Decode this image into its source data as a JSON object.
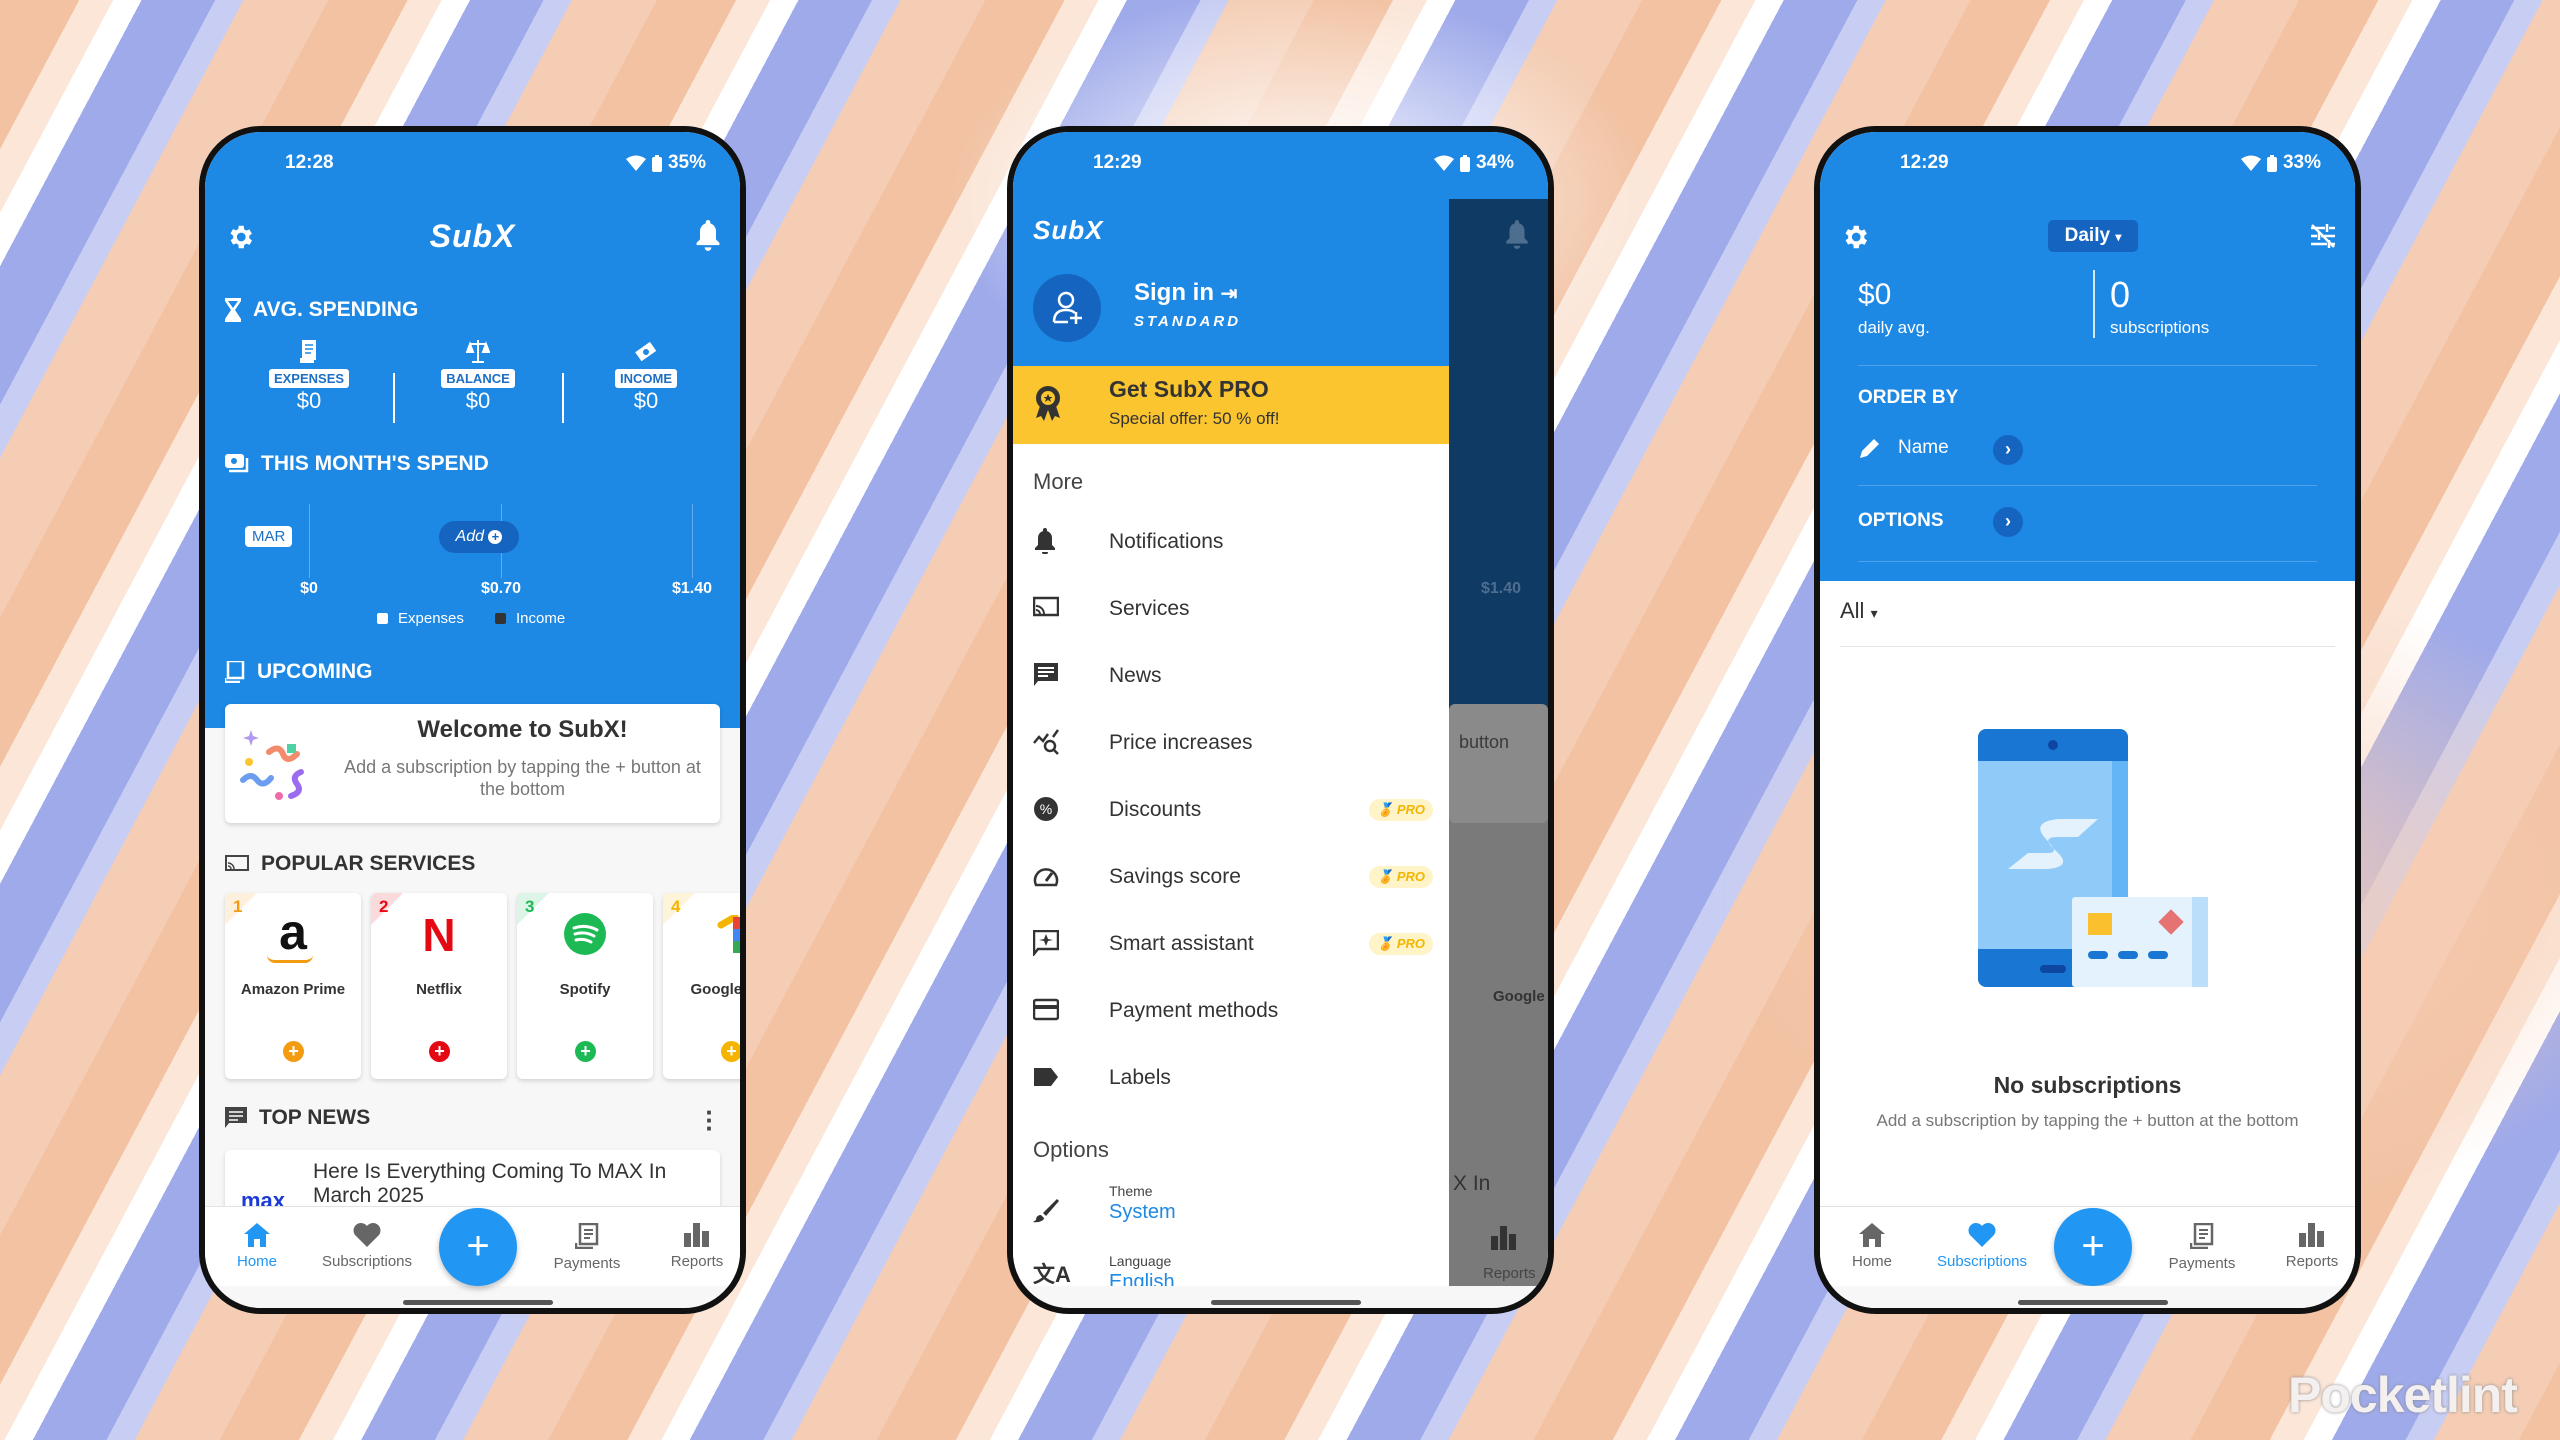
{
  "home": {
    "status": {
      "time": "12:28",
      "battery": "35%"
    },
    "logo": "SubX",
    "avg_spending": {
      "title": "AVG. SPENDING",
      "stats": [
        {
          "label": "EXPENSES",
          "value": "$0",
          "icon": "receipt-icon"
        },
        {
          "label": "BALANCE",
          "value": "$0",
          "icon": "scale-icon"
        },
        {
          "label": "INCOME",
          "value": "$0",
          "icon": "money-icon"
        }
      ]
    },
    "month_spend": {
      "title": "THIS MONTH'S SPEND",
      "month": "MAR",
      "add_label": "Add",
      "ticks": [
        "$0",
        "$0.70",
        "$1.40"
      ],
      "legend": [
        "Expenses",
        "Income"
      ]
    },
    "upcoming": {
      "title": "UPCOMING",
      "welcome_title": "Welcome to SubX!",
      "welcome_text": "Add a subscription by tapping the + button at the bottom"
    },
    "popular": {
      "title": "POPULAR SERVICES",
      "services": [
        {
          "rank": "1",
          "name": "Amazon Prime",
          "color": "#f39c12"
        },
        {
          "rank": "2",
          "name": "Netflix",
          "color": "#e50914"
        },
        {
          "rank": "3",
          "name": "Spotify",
          "color": "#1db954"
        },
        {
          "rank": "4",
          "name": "Google One",
          "color": "#f5b400"
        }
      ]
    },
    "news": {
      "title": "TOP NEWS",
      "source_logo": "max",
      "headline": "Here Is Everything Coming To MAX In March 2025"
    }
  },
  "drawer": {
    "status": {
      "time": "12:29",
      "battery": "34%"
    },
    "logo": "SubX",
    "sign_in": "Sign in",
    "plan": "STANDARD",
    "promo": {
      "title": "Get SubX PRO",
      "subtitle": "Special offer: 50 % off!"
    },
    "more_header": "More",
    "items": [
      {
        "label": "Notifications",
        "icon": "bell-icon"
      },
      {
        "label": "Services",
        "icon": "cast-icon"
      },
      {
        "label": "News",
        "icon": "message-icon"
      },
      {
        "label": "Price increases",
        "icon": "chart-search-icon"
      },
      {
        "label": "Discounts",
        "icon": "discount-icon",
        "badge": "PRO"
      },
      {
        "label": "Savings score",
        "icon": "gauge-icon",
        "badge": "PRO"
      },
      {
        "label": "Smart assistant",
        "icon": "assistant-icon",
        "badge": "PRO"
      },
      {
        "label": "Payment methods",
        "icon": "credit-card-icon"
      },
      {
        "label": "Labels",
        "icon": "label-icon"
      }
    ],
    "options_header": "Options",
    "options": [
      {
        "label": "Theme",
        "value": "System"
      },
      {
        "label": "Language",
        "value": "English"
      }
    ],
    "background": {
      "tick": "$1.40",
      "card_text": "button",
      "news_text": "X In",
      "service": "Google C"
    }
  },
  "subscriptions": {
    "status": {
      "time": "12:29",
      "battery": "33%"
    },
    "period": "Daily",
    "daily_avg": {
      "value": "$0",
      "label": "daily avg."
    },
    "count": {
      "value": "0",
      "label": "subscriptions"
    },
    "order_by": {
      "title": "ORDER BY",
      "value": "Name"
    },
    "options_title": "OPTIONS",
    "filter": "All",
    "empty": {
      "title": "No subscriptions",
      "text": "Add a subscription by tapping the + button at the bottom"
    }
  },
  "bottom_nav": {
    "items": [
      {
        "label": "Home",
        "icon": "home-icon"
      },
      {
        "label": "Subscriptions",
        "icon": "heart-icon"
      },
      {
        "label": "Payments",
        "icon": "receipt-icon"
      },
      {
        "label": "Reports",
        "icon": "bar-chart-icon"
      }
    ],
    "fab": "+"
  },
  "colors": {
    "primary": "#1e88e5",
    "accent": "#2196f3",
    "pro": "#fbc52f"
  },
  "watermark": "Pocketlint"
}
